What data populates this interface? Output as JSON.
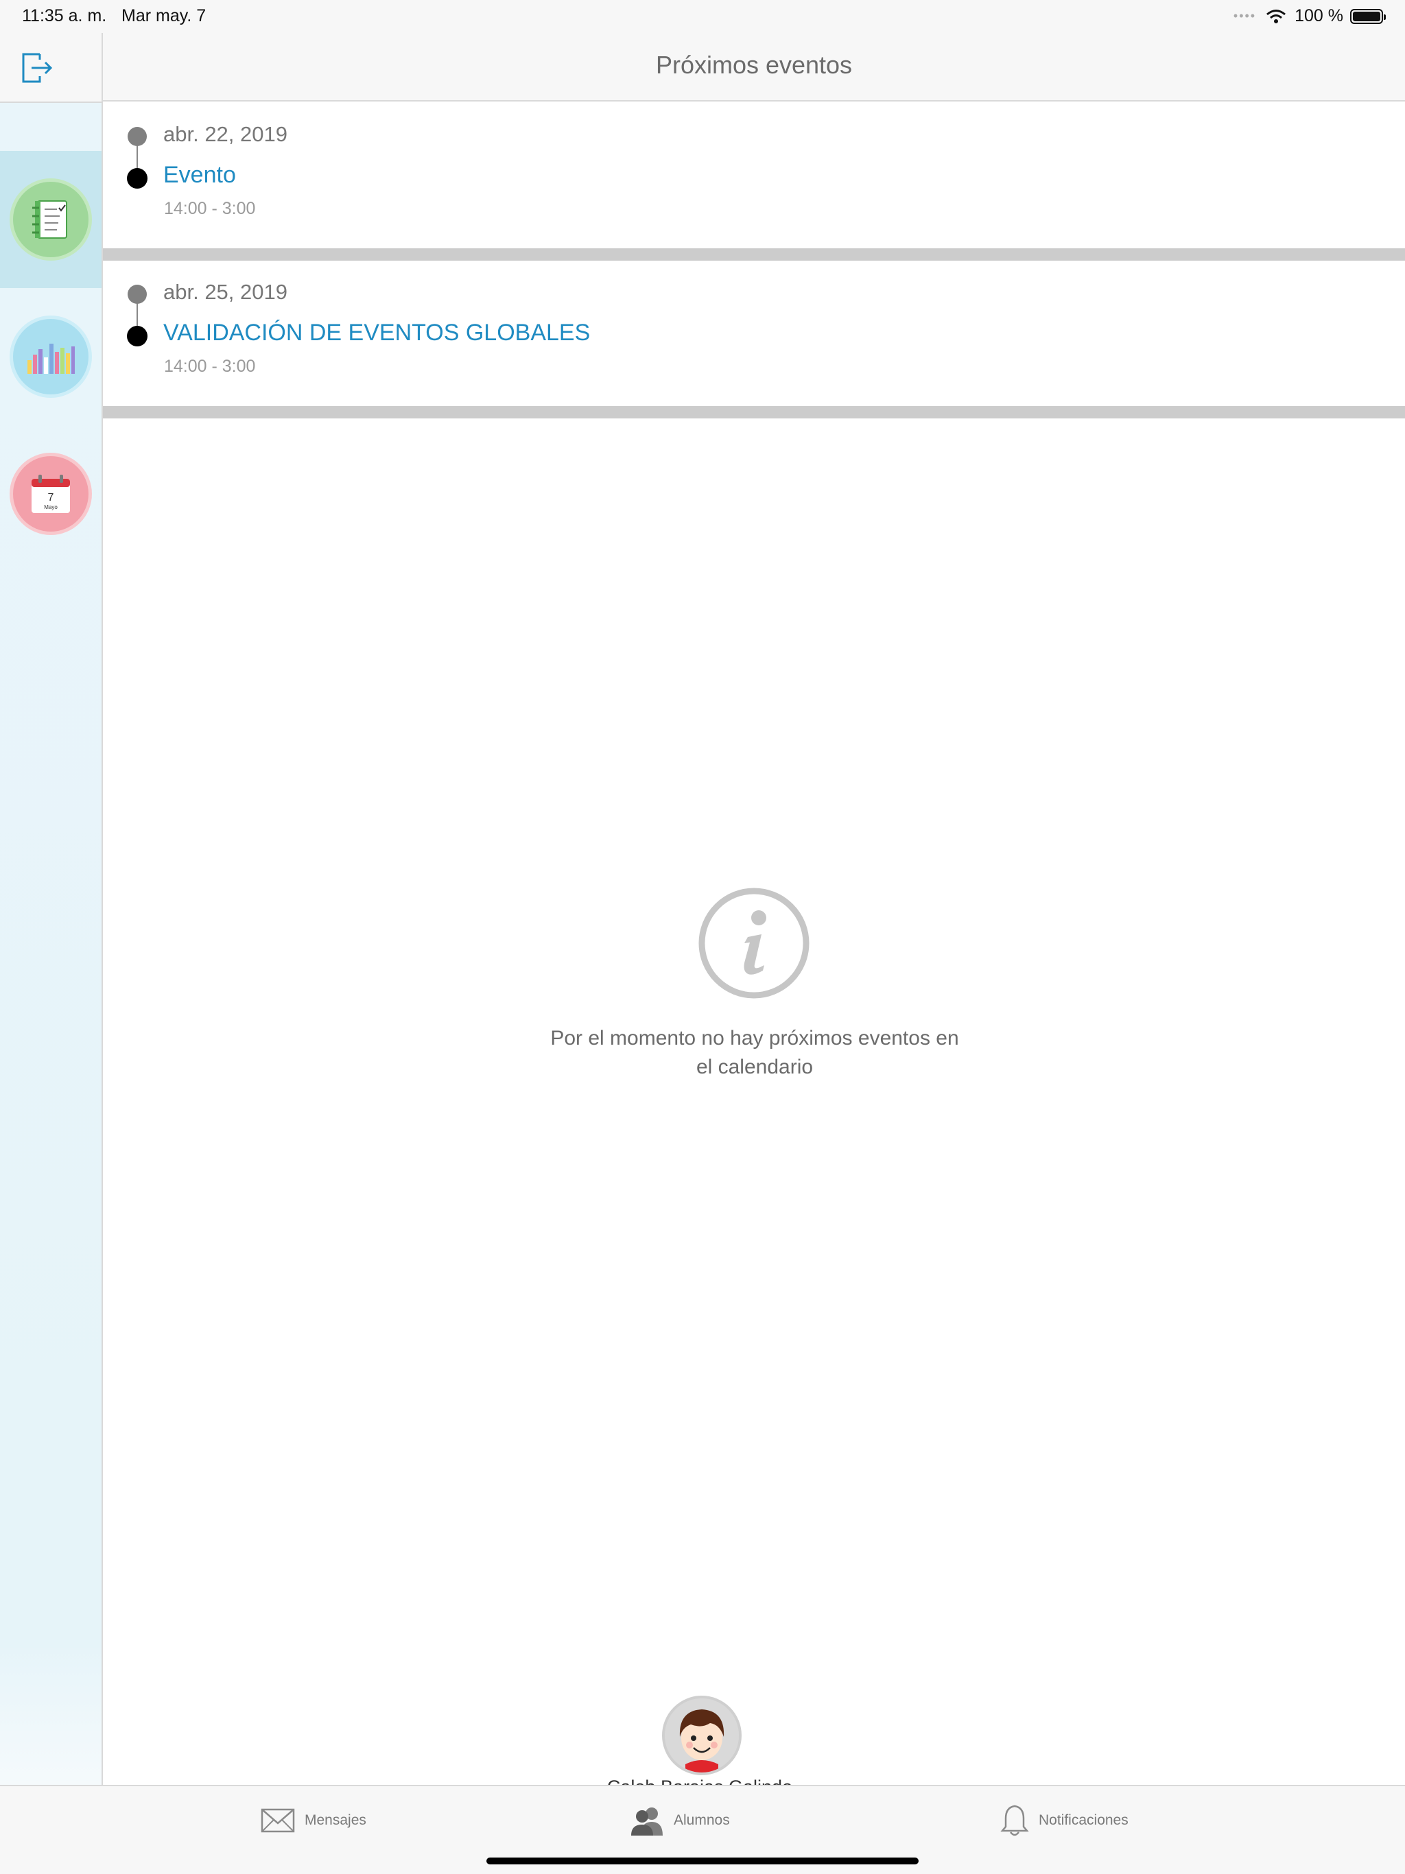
{
  "status_bar": {
    "time": "11:35 a. m.",
    "date": "Mar may. 7",
    "battery": "100 %"
  },
  "header": {
    "title": "Próximos eventos"
  },
  "sidebar": {
    "items": [
      {
        "name": "tasks",
        "icon": "notebook-checklist-icon",
        "color": "#9fd79a",
        "active": true
      },
      {
        "name": "stats",
        "icon": "bar-chart-icon",
        "color": "#a9dff0",
        "active": false
      },
      {
        "name": "calendar",
        "icon": "calendar-icon",
        "color": "#f3a0aa",
        "active": false,
        "day": "7",
        "month": "Mayo"
      }
    ]
  },
  "events": [
    {
      "date": "abr. 22, 2019",
      "title": "Evento",
      "time": "14:00 - 3:00"
    },
    {
      "date": "abr. 25, 2019",
      "title": "VALIDACIÓN DE EVENTOS GLOBALES",
      "time": "14:00 - 3:00"
    }
  ],
  "empty_state": {
    "line1": "Por el momento no hay próximos eventos en",
    "line2": "el calendario"
  },
  "student": {
    "name": "Caleb Barajas Galindo"
  },
  "tab_bar": {
    "messages": "Mensajes",
    "students": "Alumnos",
    "notifications": "Notificaciones"
  },
  "colors": {
    "accent": "#1f8bc2",
    "sidebar_bg": "#e6f4f9",
    "active_item": "#c6e6ef"
  }
}
